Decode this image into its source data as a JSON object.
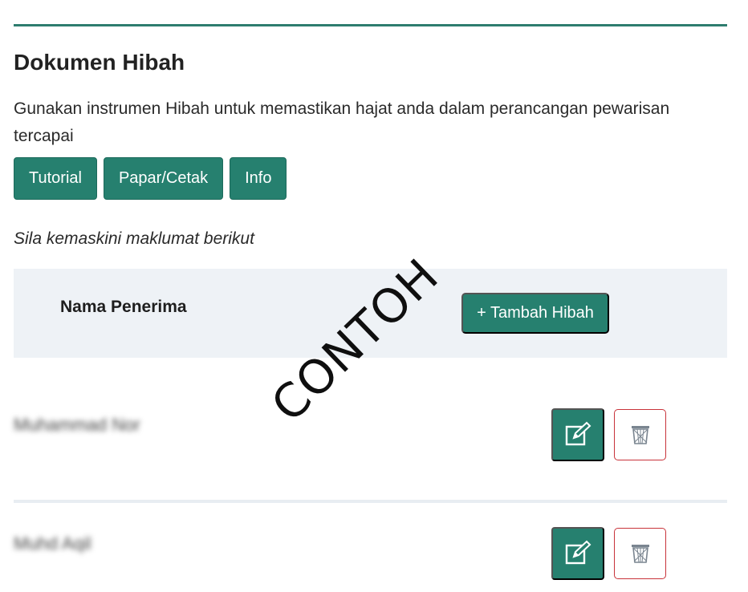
{
  "section": {
    "title": "Dokumen Hibah",
    "description": "Gunakan instrumen Hibah untuk memastikan hajat anda dalam perancangan pewarisan tercapai",
    "hint": "Sila kemaskini maklumat berikut"
  },
  "toolbar": {
    "tutorial_label": "Tutorial",
    "print_label": "Papar/Cetak",
    "info_label": "Info"
  },
  "table": {
    "column_title": "Nama Penerima",
    "add_label": "+ Tambah Hibah",
    "rows": [
      {
        "name": "Muhammad Nor"
      },
      {
        "name": "Muhd Aqil"
      }
    ]
  },
  "watermark": "CONTOH",
  "colors": {
    "primary": "#26806f",
    "danger": "#c8333a",
    "band": "#eef2f6"
  },
  "icons": {
    "edit": "edit-icon",
    "delete": "trash-icon"
  }
}
